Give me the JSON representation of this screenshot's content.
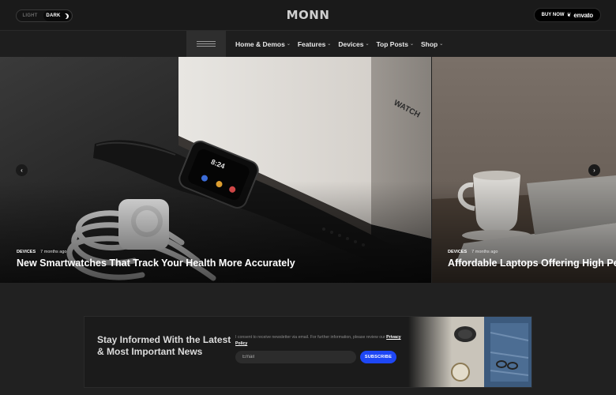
{
  "header": {
    "mode_light": "LIGHT",
    "mode_dark": "DARK",
    "logo": "MONN",
    "buy_label": "BUY NOW",
    "buy_brand": "envato"
  },
  "nav": {
    "items": [
      {
        "label": "Home & Demos"
      },
      {
        "label": "Features"
      },
      {
        "label": "Devices"
      },
      {
        "label": "Top Posts"
      },
      {
        "label": "Shop"
      }
    ]
  },
  "slides": [
    {
      "category": "DEVICES",
      "time": "7 months ago",
      "title": "New Smartwatches That Track Your Health More Accurately"
    },
    {
      "category": "DEVICES",
      "time": "7 months ago",
      "title": "Affordable Laptops Offering High Performance"
    }
  ],
  "newsletter": {
    "title": "Stay Informed With the Latest & Most Important News",
    "consent": "I consent to receive newsletter via email. For further information, please review our",
    "policy_link": "Privacy Policy",
    "email_placeholder": "Email",
    "subscribe_label": "SUBSCRIBE"
  },
  "colors": {
    "background": "#212121",
    "accent": "#1e47f5"
  }
}
